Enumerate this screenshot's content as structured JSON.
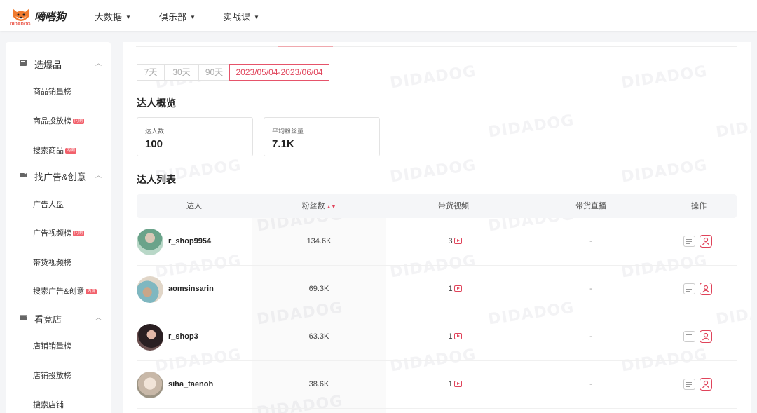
{
  "brand": {
    "logo_text": "DIDADOG",
    "name": "嘀嗒狗"
  },
  "nav": [
    {
      "label": "大数据"
    },
    {
      "label": "俱乐部"
    },
    {
      "label": "实战课"
    }
  ],
  "sidebar": {
    "groups": [
      {
        "label": "选爆品",
        "icon": "shopping-bag-icon",
        "items": [
          {
            "label": "商品销量榜",
            "badge": ""
          },
          {
            "label": "商品投放榜",
            "badge": "内测"
          },
          {
            "label": "搜索商品",
            "badge": "内测"
          }
        ]
      },
      {
        "label": "找广告&创意",
        "icon": "video-camera-icon",
        "items": [
          {
            "label": "广告大盘",
            "badge": ""
          },
          {
            "label": "广告视频榜",
            "badge": "内测"
          },
          {
            "label": "带货视频榜",
            "badge": ""
          },
          {
            "label": "搜索广告&创意",
            "badge": "内测"
          }
        ]
      },
      {
        "label": "看竞店",
        "icon": "store-icon",
        "items": [
          {
            "label": "店铺销量榜",
            "badge": ""
          },
          {
            "label": "店铺投放榜",
            "badge": ""
          },
          {
            "label": "搜索店铺",
            "badge": ""
          }
        ]
      }
    ]
  },
  "ranges": [
    "7天",
    "30天",
    "90天",
    "2023/05/04-2023/06/04"
  ],
  "overview": {
    "title": "达人概览",
    "stats": [
      {
        "label": "达人数",
        "value": "100"
      },
      {
        "label": "平均粉丝量",
        "value": "7.1K"
      }
    ]
  },
  "list": {
    "title": "达人列表",
    "columns": [
      "达人",
      "粉丝数",
      "带货视频",
      "带货直播",
      "操作"
    ],
    "rows": [
      {
        "name": "r_shop9954",
        "fans": "134.6K",
        "videos": "3",
        "live": "-"
      },
      {
        "name": "aomsinsarin",
        "fans": "69.3K",
        "videos": "1",
        "live": "-"
      },
      {
        "name": "r_shop3",
        "fans": "63.3K",
        "videos": "1",
        "live": "-"
      },
      {
        "name": "siha_taenoh",
        "fans": "38.6K",
        "videos": "1",
        "live": "-"
      }
    ]
  },
  "watermark": "DIDADOG",
  "colors": {
    "accent": "#e0435a",
    "badge": "#f2606b"
  }
}
